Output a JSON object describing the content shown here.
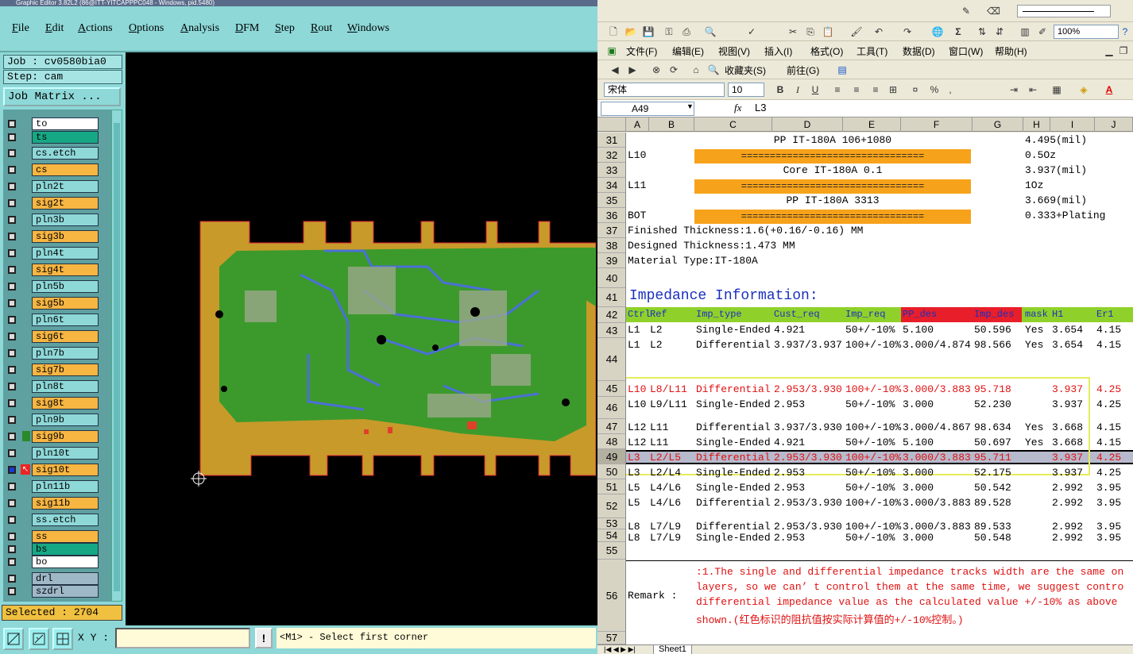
{
  "left_app": {
    "title": "Graphic Editor 3.82L2 (86@ITT-YITCAPPPC048 - Windows, pid.5480)",
    "menu": [
      "File",
      "Edit",
      "Actions",
      "Options",
      "Analysis",
      "DFM",
      "Step",
      "Rout",
      "Windows"
    ],
    "job": "Job : cv0580bia0",
    "step": "Step: cam",
    "job_matrix_label": "Job Matrix ...",
    "layers": [
      {
        "name": "to",
        "color": "#ffffff"
      },
      {
        "name": "ts",
        "color": "#16a884"
      },
      {
        "name": "cs.etch",
        "color": "#8ed8d8"
      },
      {
        "name": "cs",
        "color": "#f7b542"
      },
      {
        "name": "pln2t",
        "color": "#8ed8d8"
      },
      {
        "name": "sig2t",
        "color": "#f7b542"
      },
      {
        "name": "pln3b",
        "color": "#8ed8d8"
      },
      {
        "name": "sig3b",
        "color": "#f7b542"
      },
      {
        "name": "pln4t",
        "color": "#8ed8d8"
      },
      {
        "name": "sig4t",
        "color": "#f7b542"
      },
      {
        "name": "pln5b",
        "color": "#8ed8d8"
      },
      {
        "name": "sig5b",
        "color": "#f7b542"
      },
      {
        "name": "pln6t",
        "color": "#8ed8d8"
      },
      {
        "name": "sig6t",
        "color": "#f7b542"
      },
      {
        "name": "pln7b",
        "color": "#8ed8d8"
      },
      {
        "name": "sig7b",
        "color": "#f7b542"
      },
      {
        "name": "pln8t",
        "color": "#8ed8d8"
      },
      {
        "name": "sig8t",
        "color": "#f7b542"
      },
      {
        "name": "pln9b",
        "color": "#8ed8d8"
      },
      {
        "name": "sig9b",
        "color": "#f7b542"
      },
      {
        "name": "pln10t",
        "color": "#8ed8d8"
      },
      {
        "name": "sig10t",
        "color": "#f7b542"
      },
      {
        "name": "pln11b",
        "color": "#8ed8d8"
      },
      {
        "name": "sig11b",
        "color": "#f7b542"
      },
      {
        "name": "ss.etch",
        "color": "#8ed8d8"
      },
      {
        "name": "ss",
        "color": "#f7b542"
      },
      {
        "name": "bs",
        "color": "#16a884"
      },
      {
        "name": "bo",
        "color": "#ffffff"
      },
      {
        "name": "drl",
        "color": "#9fb8c8"
      },
      {
        "name": "szdrl",
        "color": "#9fb8c8"
      }
    ],
    "selected": "Selected : 2704",
    "xy_label": "X Y :",
    "xy_value": "",
    "excl": "!",
    "prompt": "<M1> - Select first corner"
  },
  "excel": {
    "menu": [
      "文件(F)",
      "编辑(E)",
      "视图(V)",
      "插入(I)",
      "格式(O)",
      "工具(T)",
      "数据(D)",
      "窗口(W)",
      "帮助(H)"
    ],
    "favorites": "收藏夹(S)",
    "goto": "前往(G)",
    "font": "宋体",
    "font_size": "10",
    "zoom": "100%",
    "namebox": "A49",
    "fx": "fx",
    "formula": "L3",
    "columns": [
      "A",
      "B",
      "C",
      "D",
      "E",
      "F",
      "G",
      "H",
      "I",
      "J"
    ],
    "sheet_tab": "Sheet1",
    "orange_fill": "================================",
    "stack_rows": [
      {
        "row": "31",
        "a": "",
        "text": "PP     IT-180A     106+1080",
        "h": "4.495(mil)"
      },
      {
        "row": "32",
        "a": "L10",
        "text": "",
        "h": "0.5Oz"
      },
      {
        "row": "33",
        "a": "",
        "text": "Core     IT-180A    0.1",
        "h": "3.937(mil)"
      },
      {
        "row": "34",
        "a": "L11",
        "text": "",
        "h": "1Oz"
      },
      {
        "row": "35",
        "a": "",
        "text": "PP    IT-180A    3313",
        "h": "3.669(mil)"
      },
      {
        "row": "36",
        "a": "BOT",
        "text": "",
        "h": "0.333+Plating"
      }
    ],
    "info_lines": [
      {
        "row": "37",
        "text": "Finished Thickness:1.6(+0.16/-0.16) MM"
      },
      {
        "row": "38",
        "text": "Designed Thickness:1.473 MM"
      },
      {
        "row": "39",
        "text": "Material Type:IT-180A"
      }
    ],
    "impedance_title": "Impedance Information:",
    "headers": [
      "Ctrl",
      "Ref",
      "Imp_type",
      "Cust_req",
      "Imp_req",
      "PP_des",
      "Imp_des",
      "mask",
      "H1",
      "Er1"
    ],
    "rows": [
      {
        "row": "43",
        "c": [
          "L1",
          "L2",
          "Single-Ended",
          "4.921",
          "50+/-10%",
          "5.100",
          "50.596",
          "Yes",
          "3.654",
          "4.15"
        ],
        "red": false
      },
      {
        "row": "44",
        "c": [
          "L1",
          "L2",
          "Differential",
          "3.937/3.937",
          "100+/-10%",
          "3.000/4.874",
          "98.566",
          "Yes",
          "3.654",
          "4.15"
        ],
        "red": false
      },
      {
        "row": "45",
        "c": [
          "L10",
          "L8/L11",
          "Differential",
          "2.953/3.930",
          "100+/-10%",
          "3.000/3.883",
          "95.718",
          "",
          "3.937",
          "4.25"
        ],
        "red": true
      },
      {
        "row": "46",
        "c": [
          "L10",
          "L9/L11",
          "Single-Ended",
          "2.953",
          "50+/-10%",
          "3.000",
          "52.230",
          "",
          "3.937",
          "4.25"
        ],
        "red": false
      },
      {
        "row": "47",
        "c": [
          "L12",
          "L11",
          "Differential",
          "3.937/3.930",
          "100+/-10%",
          "3.000/4.867",
          "98.634",
          "Yes",
          "3.668",
          "4.15"
        ],
        "red": false
      },
      {
        "row": "48",
        "c": [
          "L12",
          "L11",
          "Single-Ended",
          "4.921",
          "50+/-10%",
          "5.100",
          "50.697",
          "Yes",
          "3.668",
          "4.15"
        ],
        "red": false
      },
      {
        "row": "49",
        "c": [
          "L3",
          "L2/L5",
          "Differential",
          "2.953/3.930",
          "100+/-10%",
          "3.000/3.883",
          "95.711",
          "",
          "3.937",
          "4.25"
        ],
        "red": true
      },
      {
        "row": "50",
        "c": [
          "L3",
          "L2/L4",
          "Single-Ended",
          "2.953",
          "50+/-10%",
          "3.000",
          "52.175",
          "",
          "3.937",
          "4.25"
        ],
        "red": false
      },
      {
        "row": "51",
        "c": [
          "L5",
          "L4/L6",
          "Single-Ended",
          "2.953",
          "50+/-10%",
          "3.000",
          "50.542",
          "",
          "2.992",
          "3.95"
        ],
        "red": false
      },
      {
        "row": "52",
        "c": [
          "L5",
          "L4/L6",
          "Differential",
          "2.953/3.930",
          "100+/-10%",
          "3.000/3.883",
          "89.528",
          "",
          "2.992",
          "3.95"
        ],
        "red": false
      },
      {
        "row": "53",
        "c": [
          "L8",
          "L7/L9",
          "Differential",
          "2.953/3.930",
          "100+/-10%",
          "3.000/3.883",
          "89.533",
          "",
          "2.992",
          "3.95"
        ],
        "red": false
      },
      {
        "row": "54",
        "c": [
          "L8",
          "L7/L9",
          "Single-Ended",
          "2.953",
          "50+/-10%",
          "3.000",
          "50.548",
          "",
          "2.992",
          "3.95"
        ],
        "red": false
      }
    ],
    "remark_label": "Remark :",
    "remark_lines": [
      ":1.The single and differential impedance tracks width are the same on",
      "layers, so we can’ t control them at the same time, we suggest contro",
      "differential impedance value as the calculated value +/-10% as above",
      "shown.(红色标识的阻抗值按实际计算值的+/-10%控制。)"
    ],
    "row_numbers": [
      "31",
      "32",
      "33",
      "34",
      "35",
      "36",
      "37",
      "38",
      "39",
      "40",
      "41",
      "42",
      "43",
      "44",
      "45",
      "46",
      "47",
      "48",
      "49",
      "50",
      "51",
      "52",
      "53",
      "54",
      "55",
      "56",
      "57"
    ]
  }
}
